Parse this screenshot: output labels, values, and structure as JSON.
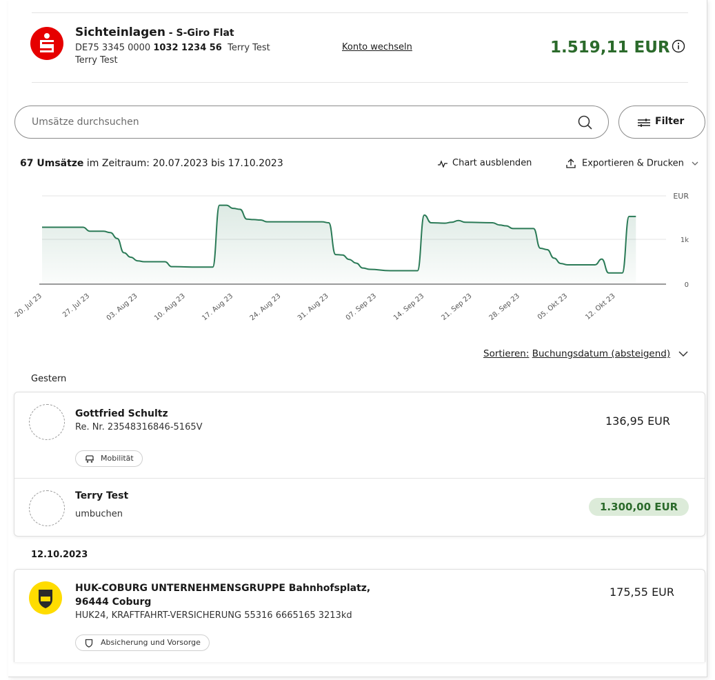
{
  "account": {
    "name": "Sichteinlagen",
    "separator": " - ",
    "product": "S-Giro Flat",
    "iban_prefix": "DE75 3345 0000 ",
    "iban_bold": "1032 1234 56",
    "iban_owner": "Terry Test",
    "owner": "Terry Test",
    "switch_label": "Konto wechseln",
    "balance": "1.519,11 EUR",
    "brand_color": "#e60000",
    "balance_color": "#2b6a2b"
  },
  "search": {
    "placeholder": "Umsätze durchsuchen",
    "icon": "search-icon"
  },
  "filter": {
    "label": "Filter",
    "icon": "filter-icon"
  },
  "summary": {
    "count": "67 Umsätze",
    "range_text": " im Zeitraum: 20.07.2023 bis 17.10.2023"
  },
  "actions": {
    "chart_toggle": "Chart ausblenden",
    "export": "Exportieren & Drucken"
  },
  "chart_data": {
    "type": "area",
    "ylabel": "EUR",
    "y_ticks": [
      "0",
      "1k"
    ],
    "ylim": [
      0,
      2000
    ],
    "line_color": "#2a7a56",
    "x_ticks": [
      "20. Jul 23",
      "27. Jul 23",
      "03. Aug 23",
      "10. Aug 23",
      "17. Aug 23",
      "24. Aug 23",
      "31. Aug 23",
      "07. Sep 23",
      "14. Sep 23",
      "21. Sep 23",
      "28. Sep 23",
      "05. Okt 23",
      "12. Okt 23"
    ],
    "x_days": [
      0,
      7,
      14,
      21,
      28,
      35,
      42,
      49,
      56,
      63,
      70,
      77,
      84
    ],
    "points": [
      [
        0,
        1270
      ],
      [
        5,
        1270
      ],
      [
        6,
        1270
      ],
      [
        7,
        1180
      ],
      [
        9,
        1180
      ],
      [
        10,
        1150
      ],
      [
        11,
        1020
      ],
      [
        12,
        700
      ],
      [
        13,
        600
      ],
      [
        14,
        520
      ],
      [
        15,
        500
      ],
      [
        18,
        500
      ],
      [
        19,
        390
      ],
      [
        23,
        380
      ],
      [
        25,
        380
      ],
      [
        26,
        1760
      ],
      [
        27,
        1760
      ],
      [
        28,
        1690
      ],
      [
        29,
        1670
      ],
      [
        30,
        1450
      ],
      [
        31,
        1440
      ],
      [
        32,
        1430
      ],
      [
        33,
        1390
      ],
      [
        39,
        1390
      ],
      [
        41,
        1390
      ],
      [
        42,
        1370
      ],
      [
        43,
        660
      ],
      [
        44,
        650
      ],
      [
        45,
        550
      ],
      [
        46,
        470
      ],
      [
        47,
        360
      ],
      [
        48,
        330
      ],
      [
        51,
        300
      ],
      [
        55,
        300
      ],
      [
        56,
        1540
      ],
      [
        57,
        1370
      ],
      [
        59,
        1360
      ],
      [
        60,
        1380
      ],
      [
        61,
        1420
      ],
      [
        62,
        1380
      ],
      [
        66,
        1370
      ],
      [
        67,
        1320
      ],
      [
        68,
        1300
      ],
      [
        69,
        1240
      ],
      [
        72,
        1240
      ],
      [
        73,
        800
      ],
      [
        74,
        770
      ],
      [
        75,
        580
      ],
      [
        76,
        460
      ],
      [
        77,
        430
      ],
      [
        81,
        430
      ],
      [
        82,
        560
      ],
      [
        83,
        250
      ],
      [
        85,
        250
      ],
      [
        86,
        1510
      ],
      [
        87,
        1510
      ]
    ]
  },
  "sort": {
    "prefix": "Sortieren:",
    "value": "Buchungsdatum (absteigend)"
  },
  "groups": [
    {
      "label": "Gestern",
      "transactions": [
        {
          "name": "Gottfried Schultz",
          "ref": "Re. Nr.  23548316846-5165V",
          "amount": "136,95 EUR",
          "category": "Mobilität",
          "category_icon": "car-icon"
        },
        {
          "name": "Terry Test",
          "ref": "umbuchen",
          "amount": "1.300,00 EUR",
          "positive": true
        }
      ]
    },
    {
      "label": "12.10.2023",
      "transactions": [
        {
          "name_line1": "HUK-COBURG UNTERNEHMENSGRUPPE Bahnhofsplatz,",
          "name_line2": "96444 Coburg",
          "ref": "HUK24, KRAFTFAHRT-VERSICHERUNG  55316 6665165 3213kd",
          "amount": "175,55 EUR",
          "category": "Absicherung und Vorsorge",
          "category_icon": "shield-icon",
          "logo_text": "HUK"
        }
      ]
    }
  ]
}
